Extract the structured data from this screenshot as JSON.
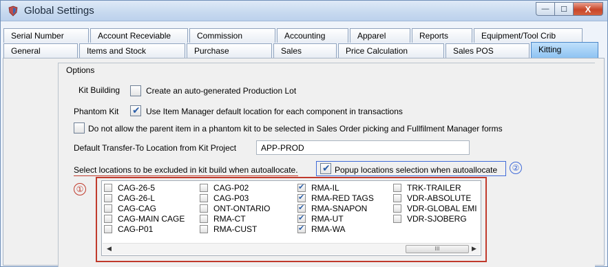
{
  "window": {
    "title": "Global Settings",
    "min_glyph": "—",
    "max_glyph": "☐",
    "close_glyph": "X"
  },
  "tabs": {
    "row1": [
      {
        "label": "Serial Number",
        "width": 124
      },
      {
        "label": "Account Receviable",
        "width": 142
      },
      {
        "label": "Commission",
        "width": 125
      },
      {
        "label": "Accounting",
        "width": 104
      },
      {
        "label": "Apparel",
        "width": 88
      },
      {
        "label": "Reports",
        "width": 88
      },
      {
        "label": "Equipment/Tool Crib",
        "width": 158
      }
    ],
    "row2": [
      {
        "label": "General",
        "width": 108
      },
      {
        "label": "Items and Stock",
        "width": 154
      },
      {
        "label": "Purchase",
        "width": 124
      },
      {
        "label": "Sales",
        "width": 92
      },
      {
        "label": "Price Calculation",
        "width": 154
      },
      {
        "label": "Sales POS",
        "width": 122
      },
      {
        "label": "Kitting",
        "width": 98,
        "active": true
      }
    ]
  },
  "options": {
    "group_label": "Options",
    "kit_building_label": "Kit Building",
    "kit_building_option": "Create an auto-generated Production Lot",
    "kit_building_checked": false,
    "phantom_kit_label": "Phantom Kit",
    "phantom_kit_option": "Use Item Manager default location for each component in transactions",
    "phantom_kit_checked": true,
    "parent_item_option": "Do not allow the parent item in a phantom kit to be selected in Sales Order picking and Fullfilment Manager forms",
    "parent_item_checked": false,
    "transfer_label": "Default Transfer-To Location from Kit Project",
    "transfer_value": "APP-PROD",
    "exclude_label": "Select locations to be excluded in kit build when autoallocate.",
    "popup_option": "Popup locations selection when autoallocate",
    "popup_checked": true,
    "marker_1": "①",
    "marker_2": "②"
  },
  "locations": {
    "columns": [
      [
        {
          "name": "CAG-26-5",
          "checked": false
        },
        {
          "name": "CAG-26-L",
          "checked": false
        },
        {
          "name": "CAG-CAG",
          "checked": false
        },
        {
          "name": "CAG-MAIN CAGE",
          "checked": false
        },
        {
          "name": "CAG-P01",
          "checked": false
        }
      ],
      [
        {
          "name": "CAG-P02",
          "checked": false
        },
        {
          "name": "CAG-P03",
          "checked": false
        },
        {
          "name": "ONT-ONTARIO",
          "checked": false
        },
        {
          "name": "RMA-CT",
          "checked": false
        },
        {
          "name": "RMA-CUST",
          "checked": false
        }
      ],
      [
        {
          "name": "RMA-IL",
          "checked": true
        },
        {
          "name": "RMA-RED TAGS",
          "checked": true
        },
        {
          "name": "RMA-SNAPON",
          "checked": true
        },
        {
          "name": "RMA-UT",
          "checked": true
        },
        {
          "name": "RMA-WA",
          "checked": true
        }
      ],
      [
        {
          "name": "TRK-TRAILER",
          "checked": false
        },
        {
          "name": "VDR-ABSOLUTE",
          "checked": false
        },
        {
          "name": "VDR-GLOBAL EMI",
          "checked": false
        },
        {
          "name": "VDR-SJOBERG",
          "checked": false
        }
      ]
    ],
    "scroll_left": "◀",
    "scroll_right": "▶",
    "scroll_grip": "III"
  },
  "colors": {
    "annotation_red": "#c0392b",
    "annotation_blue": "#3f6ad8",
    "active_tab": "#8fc3f2"
  }
}
